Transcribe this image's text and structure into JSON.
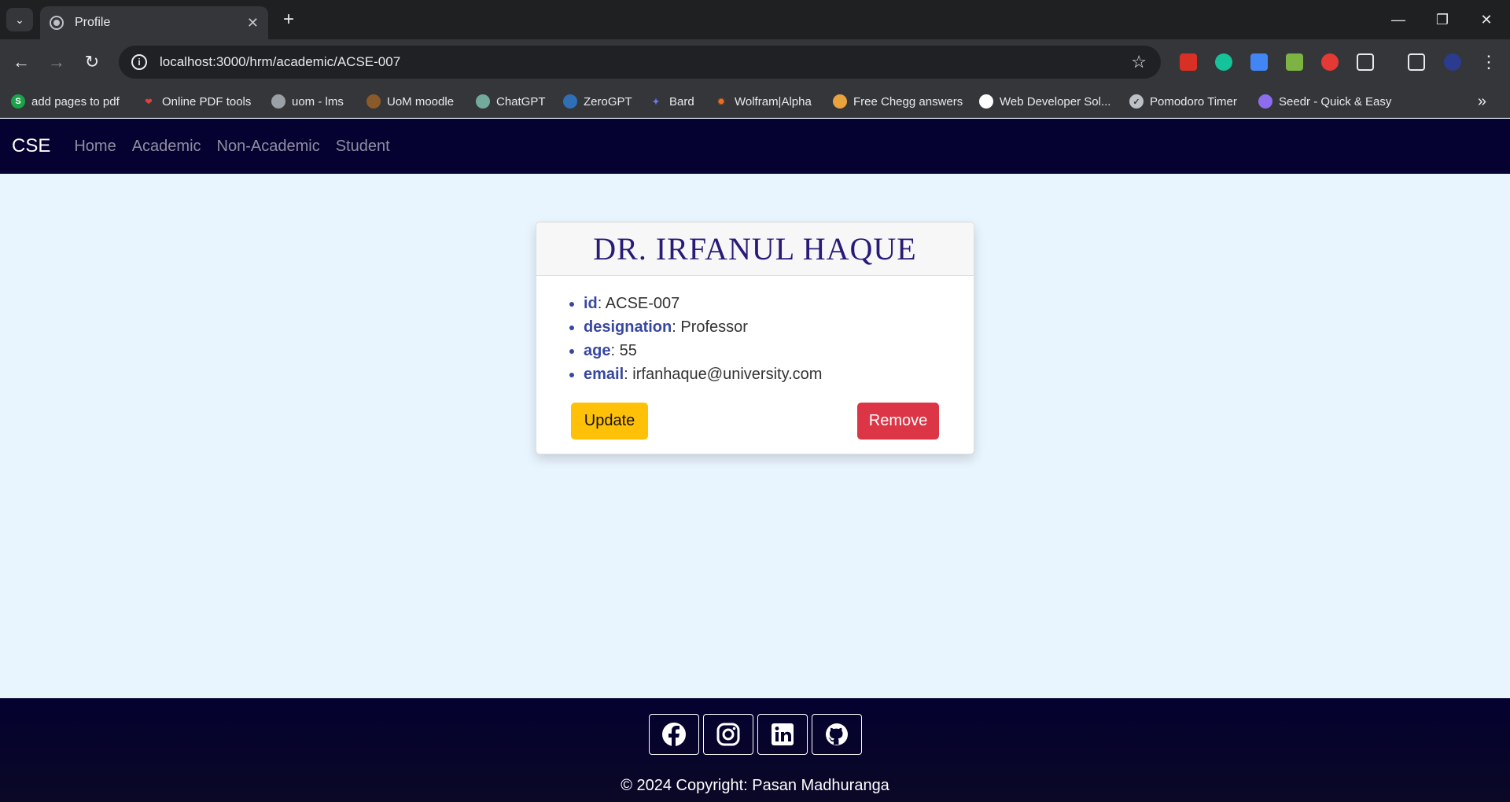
{
  "browser": {
    "tab_title": "Profile",
    "url": "localhost:3000/hrm/academic/ACSE-007",
    "bookmarks": [
      {
        "label": "add pages to pdf",
        "icon": "s-icon",
        "color": "#1aa34a"
      },
      {
        "label": "Online PDF tools",
        "icon": "heart-icon",
        "color": "#e0403a"
      },
      {
        "label": "uom - lms",
        "icon": "globe-icon",
        "color": "#9aa0a6"
      },
      {
        "label": "UoM moodle",
        "icon": "moodle-icon",
        "color": "#8a5a2b"
      },
      {
        "label": "ChatGPT",
        "icon": "chatgpt-icon",
        "color": "#74aa9c"
      },
      {
        "label": "ZeroGPT",
        "icon": "zerogpt-icon",
        "color": "#2f6fb5"
      },
      {
        "label": "Bard",
        "icon": "sparkle-icon",
        "color": "#6b7cf5"
      },
      {
        "label": "Wolfram|Alpha",
        "icon": "wolfram-icon",
        "color": "#f26b1d"
      },
      {
        "label": "Free Chegg answers",
        "icon": "books-icon",
        "color": "#e8a33d"
      },
      {
        "label": "Web Developer Sol...",
        "icon": "github-icon",
        "color": "#ffffff"
      },
      {
        "label": "Pomodoro Timer",
        "icon": "check-icon",
        "color": "#bdc1c6"
      },
      {
        "label": "Seedr - Quick & Easy",
        "icon": "seedr-icon",
        "color": "#8e6cf0"
      }
    ]
  },
  "navbar": {
    "brand": "CSE",
    "links": [
      "Home",
      "Academic",
      "Non-Academic",
      "Student"
    ]
  },
  "profile": {
    "name": "DR. IRFANUL HAQUE",
    "fields": [
      {
        "key": "id",
        "value": "ACSE-007"
      },
      {
        "key": "designation",
        "value": "Professor"
      },
      {
        "key": "age",
        "value": "55"
      },
      {
        "key": "email",
        "value": "irfanhaque@university.com"
      }
    ],
    "update_label": "Update",
    "remove_label": "Remove"
  },
  "footer": {
    "social": [
      "facebook-icon",
      "instagram-icon",
      "linkedin-icon",
      "github-icon"
    ],
    "copyright": "© 2024 Copyright: Pasan Madhuranga"
  },
  "colors": {
    "navbar_bg": "#050130",
    "page_bg": "#e8f4fe",
    "update": "#ffc107",
    "remove": "#dc3545",
    "title": "#2a1a78"
  }
}
